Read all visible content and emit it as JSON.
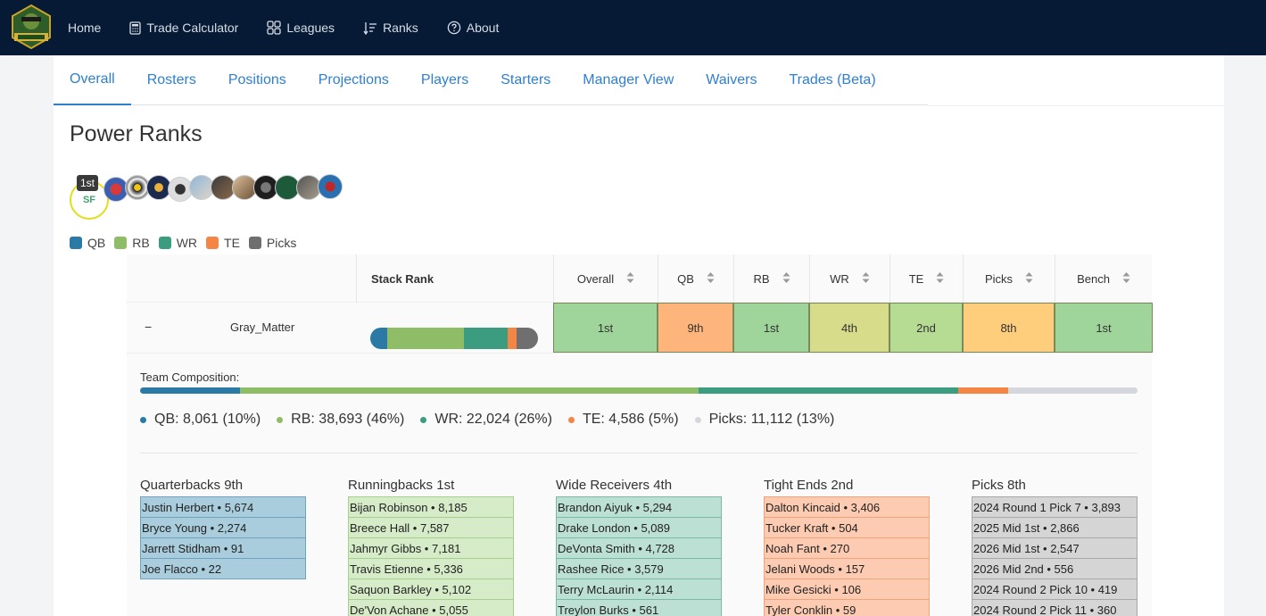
{
  "nav": {
    "items": [
      {
        "label": "Home",
        "icon": "home"
      },
      {
        "label": "Trade Calculator",
        "icon": "calculator-icon"
      },
      {
        "label": "Leagues",
        "icon": "grid-icon"
      },
      {
        "label": "Ranks",
        "icon": "sort-icon"
      },
      {
        "label": "About",
        "icon": "help-circle-icon"
      }
    ]
  },
  "tabs": [
    "Overall",
    "Rosters",
    "Positions",
    "Projections",
    "Players",
    "Starters",
    "Manager View",
    "Waivers",
    "Trades (Beta)"
  ],
  "page_title": "Power Ranks",
  "current_rank_badge": "1st",
  "avatar_initials": "SF",
  "legend": [
    {
      "label": "QB",
      "color": "#2a7aa5"
    },
    {
      "label": "RB",
      "color": "#8fbd67"
    },
    {
      "label": "WR",
      "color": "#3c9c80"
    },
    {
      "label": "TE",
      "color": "#f48544"
    },
    {
      "label": "Picks",
      "color": "#6f6f6f"
    }
  ],
  "table": {
    "headers": [
      "Stack Rank",
      "Overall",
      "QB",
      "RB",
      "WR",
      "TE",
      "Picks",
      "Bench"
    ],
    "row": {
      "manager": "Gray_Matter",
      "ranks": [
        "1st",
        "9th",
        "1st",
        "4th",
        "2nd",
        "8th",
        "1st"
      ],
      "rank_colors": [
        "#9fd59a",
        "#fdb57b",
        "#9fd59a",
        "#d6dc8a",
        "#b6db92",
        "#fece7c",
        "#9fd59a"
      ]
    }
  },
  "composition": {
    "label": "Team Composition:",
    "items": [
      {
        "label": "QB: 8,061 (10%)",
        "pct": 10,
        "color": "#2a7aa5"
      },
      {
        "label": "RB: 38,693 (46%)",
        "pct": 46,
        "color": "#8fbd67"
      },
      {
        "label": "WR: 22,024 (26%)",
        "pct": 26,
        "color": "#3c9c80"
      },
      {
        "label": "TE: 4,586 (5%)",
        "pct": 5,
        "color": "#f48544"
      },
      {
        "label": "Picks: 11,112 (13%)",
        "pct": 13,
        "color": "#d4d7db"
      }
    ]
  },
  "groups": [
    {
      "title": "Quarterbacks 9th",
      "bg": "#a9cddc",
      "border": "#6ea3bf",
      "players": [
        "Justin Herbert • 5,674",
        "Bryce Young • 2,274",
        "Jarrett Stidham • 91",
        "Joe Flacco • 22"
      ]
    },
    {
      "title": "Runningbacks 1st",
      "bg": "#d6ebc7",
      "border": "#a8cf8d",
      "players": [
        "Bijan Robinson • 8,185",
        "Breece Hall • 7,587",
        "Jahmyr Gibbs • 7,181",
        "Travis Etienne • 5,336",
        "Saquon Barkley • 5,102",
        "De'Von Achane • 5,055"
      ]
    },
    {
      "title": "Wide Receivers 4th",
      "bg": "#bde0d4",
      "border": "#79bca6",
      "players": [
        "Brandon Aiyuk • 5,294",
        "Drake London • 5,089",
        "DeVonta Smith • 4,728",
        "Rashee Rice • 3,579",
        "Terry McLaurin • 2,114",
        "Treylon Burks • 561"
      ]
    },
    {
      "title": "Tight Ends 2nd",
      "bg": "#fccbb2",
      "border": "#f0a47c",
      "players": [
        "Dalton Kincaid • 3,406",
        "Tucker Kraft • 504",
        "Noah Fant • 270",
        "Jelani Woods • 157",
        "Mike Gesicki • 106",
        "Tyler Conklin • 59"
      ]
    },
    {
      "title": "Picks 8th",
      "bg": "#d5d5d5",
      "border": "#a8a8a8",
      "players": [
        "2024 Round 1 Pick 7 • 3,893",
        "2025 Mid 1st • 2,866",
        "2026 Mid 1st • 2,547",
        "2026 Mid 2nd • 556",
        "2024 Round 2 Pick 10 • 419",
        "2024 Round 2 Pick 11 • 360"
      ]
    }
  ]
}
